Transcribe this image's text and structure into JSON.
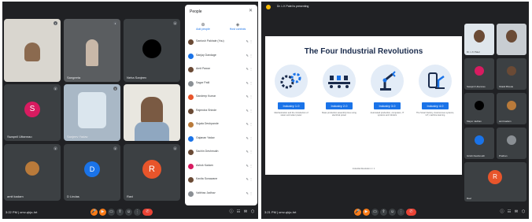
{
  "left_window": {
    "tiles": [
      {
        "id": "t1",
        "name": ""
      },
      {
        "id": "t2",
        "name": "Sangeeta"
      },
      {
        "id": "t3",
        "name": "Neha Sanjeev"
      },
      {
        "id": "t4",
        "name": "Swapnil Uttamrao",
        "initial": "S"
      },
      {
        "id": "t5",
        "name": "Sanjeev Yadav"
      },
      {
        "id": "t6",
        "name": ""
      },
      {
        "id": "t7",
        "name": "amit kadam"
      },
      {
        "id": "t8",
        "name": "D Lindas",
        "initial": "D"
      },
      {
        "id": "t9",
        "name": "Ravi",
        "initial": "R"
      }
    ],
    "people_panel": {
      "title": "People",
      "close": "✕",
      "actions": [
        {
          "label": "Add people",
          "icon": "person-add-icon"
        },
        {
          "label": "Host controls",
          "icon": "shield-icon"
        }
      ],
      "participants": [
        "Santosh Pakhale (You)",
        "Sanjay Dandage",
        "Amit Pawar",
        "Sagar Patil",
        "Sandeep Kumar",
        "Rajendra Shinde",
        "Sujata Deshpande",
        "Gajanan Yadav",
        "Sachin Deshmukh",
        "Ashok Kadam",
        "Kavita Sonawane",
        "Vaibhav Jadhav"
      ]
    },
    "toolbar": {
      "time": "3:22 PM",
      "meeting_code": "omv-qkjo-hrt"
    }
  },
  "right_window": {
    "presenting_banner": "Dr. L K Patel is presenting",
    "slide": {
      "title": "The Four Industrial Revolutions",
      "stages": [
        {
          "label": "Industry 1.0",
          "desc": "Mechanization and the introduction of steam and water power"
        },
        {
          "label": "Industry 2.0",
          "desc": "Mass production assembly lines using electrical power"
        },
        {
          "label": "Industry 3.0",
          "desc": "Automated production, computers, IT systems and robotics"
        },
        {
          "label": "Industry 4.0",
          "desc": "The Smart Factory. Autonomous systems, IoT, machine learning"
        }
      ],
      "footer": "Industrial Revolution   1 / 1"
    },
    "tiles": [
      {
        "id": "r1",
        "name": "Dr. L K Patel"
      },
      {
        "id": "r2",
        "name": ""
      },
      {
        "id": "r3",
        "name": "Swapnil Uttamrao",
        "initial": ""
      },
      {
        "id": "r4",
        "name": "Shakil Bhosle"
      },
      {
        "id": "r5",
        "name": "Mayur Jadhav"
      },
      {
        "id": "r6",
        "name": "amit kadam"
      },
      {
        "id": "r7",
        "name": "Girish Deshmukh"
      },
      {
        "id": "r8",
        "name": "Prathan"
      },
      {
        "id": "r9",
        "name": "Ravi",
        "initial": "R"
      }
    ],
    "toolbar": {
      "time": "3:21 PM",
      "meeting_code": "omv-qkjo-hrt"
    }
  },
  "colors": {
    "meet_bg": "#202124",
    "tile_bg": "#3c4043",
    "accent_blue": "#1a73e8",
    "end_call_red": "#ea4335",
    "avatar_pink": "#d81b60",
    "avatar_orange": "#e8552b"
  }
}
